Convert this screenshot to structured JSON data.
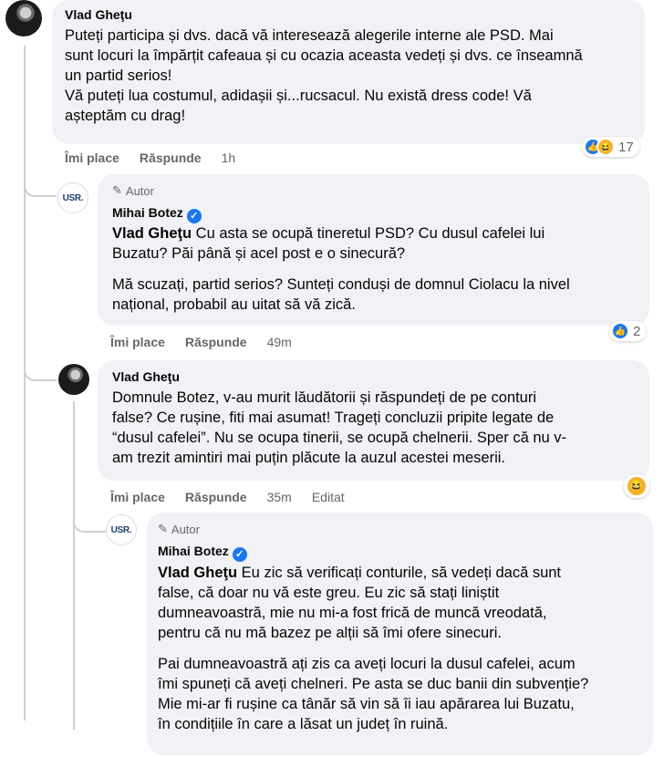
{
  "comments": [
    {
      "author": "Vlad Gheţu",
      "lines": [
        "Puteți participa și dvs. dacă vă interesează alegerile interne ale PSD. Mai",
        "sunt locuri la împărțit cafeaua și cu ocazia aceasta vedeți și dvs. ce înseamnă",
        "un partid serios!",
        "Vă puteți lua costumul, adidașii și...rucsacul. Nu există dress code! Vă",
        "așteptăm cu drag!"
      ],
      "like_label": "Îmi place",
      "reply_label": "Răspunde",
      "time": "1h",
      "reaction_count": "17"
    },
    {
      "badge": "Autor",
      "author": "Mihai Botez",
      "avatar_text": "USR.",
      "mention": "Vlad Gheţu",
      "first_line_rest": " Cu asta se ocupă tineretul PSD? Cu dusul cafelei lui",
      "lines": [
        "Buzatu? Păi până și acel post e o sinecură?"
      ],
      "para2": [
        "Mă scuzați, partid serios? Sunteți conduși de domnul Ciolacu la nivel",
        "național, probabil au uitat să vă zică."
      ],
      "like_label": "Îmi place",
      "reply_label": "Răspunde",
      "time": "49m",
      "reaction_count": "2"
    },
    {
      "author": "Vlad Gheţu",
      "lines": [
        "Domnule Botez, v-au murit lăudătorii și răspundeți de pe conturi",
        "false? Ce rușine, fiti mai asumat! Trageți concluzii pripite legate de",
        "“dusul cafelei”. Nu se ocupa tinerii, se ocupă chelnerii. Sper că nu v-",
        "am trezit amintiri mai puțin plăcute la auzul acestei meserii."
      ],
      "like_label": "Îmi place",
      "reply_label": "Răspunde",
      "time": "35m",
      "edited": "Editat"
    },
    {
      "badge": "Autor",
      "author": "Mihai Botez",
      "avatar_text": "USR.",
      "mention": "Vlad Gheţu",
      "first_line_rest": " Eu zic să verificați conturile, să vedeți dacă sunt",
      "lines": [
        "false, că doar nu vă este greu. Eu zic să stați liniștit",
        "dumneavoastră, mie nu mi-a fost frică de muncă vreodată,",
        "pentru că nu mă bazez pe alții să îmi ofere sinecuri."
      ],
      "para2": [
        "Pai dumneavoastră ați zis ca aveți locuri la dusul cafelei, acum",
        "îmi spuneți că aveți chelneri. Pe asta se duc banii din subvenție?",
        "Mie mi-ar fi rușine ca tânăr să vin să îi iau apărarea lui Buzatu,",
        "în condițiile în care a lăsat un județ în ruină."
      ]
    }
  ]
}
